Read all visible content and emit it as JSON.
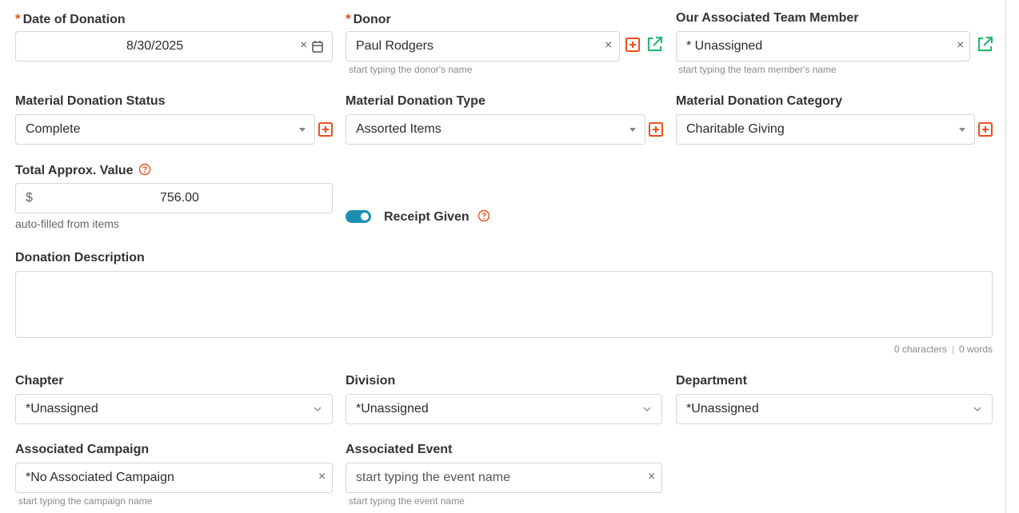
{
  "date": {
    "label": "Date of Donation",
    "value": "8/30/2025"
  },
  "donor": {
    "label": "Donor",
    "value": "Paul Rodgers",
    "hint": "start typing the donor's name"
  },
  "team_member": {
    "label": "Our Associated Team Member",
    "value": "* Unassigned",
    "hint": "start typing the team member's name"
  },
  "status": {
    "label": "Material Donation Status",
    "value": "Complete"
  },
  "type": {
    "label": "Material Donation Type",
    "value": "Assorted Items"
  },
  "category": {
    "label": "Material Donation Category",
    "value": "Charitable Giving"
  },
  "total": {
    "label": "Total Approx. Value",
    "currency": "$",
    "value": "756.00",
    "hint": "auto-filled from items"
  },
  "receipt": {
    "label": "Receipt Given",
    "on": true
  },
  "description": {
    "label": "Donation Description",
    "value": "",
    "chars": "0 characters",
    "sep": "|",
    "words": "0 words"
  },
  "chapter": {
    "label": "Chapter",
    "value": "*Unassigned"
  },
  "division": {
    "label": "Division",
    "value": "*Unassigned"
  },
  "department": {
    "label": "Department",
    "value": "*Unassigned"
  },
  "campaign": {
    "label": "Associated Campaign",
    "value": "*No Associated Campaign",
    "hint": "start typing the campaign name"
  },
  "event": {
    "label": "Associated Event",
    "placeholder": "start typing the event name",
    "hint": "start typing the event name"
  },
  "symbols": {
    "required": "*",
    "clear": "×"
  },
  "colors": {
    "accent_orange": "#e8501e",
    "accent_green": "#2bb673",
    "toggle_blue": "#1c8fb0"
  },
  "icons": [
    "calendar-icon",
    "add-icon",
    "open-external-icon",
    "help-icon",
    "chevron-down-icon",
    "caret-down-icon",
    "clear-icon"
  ]
}
